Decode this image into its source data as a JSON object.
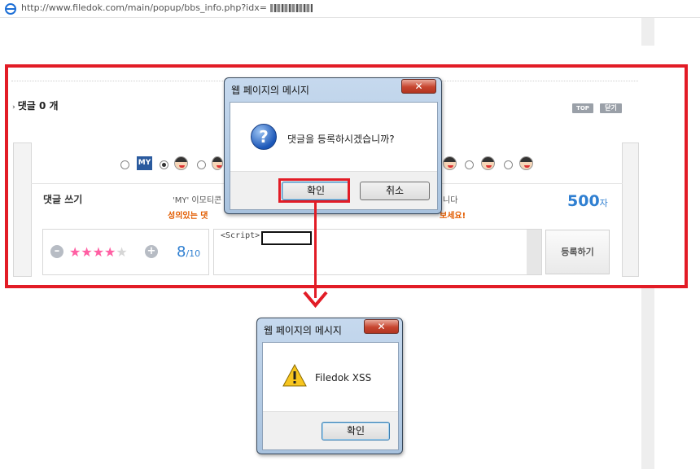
{
  "browser": {
    "url": "http://www.filedok.com/main/popup/bbs_info.php?idx="
  },
  "page": {
    "comment_count_label": "댓글 0 개",
    "top_button": "TOP",
    "close_button": "닫기",
    "emoticon_badge": "MY",
    "write_label": "댓글 쓰기",
    "notice_line1_start": "'MY' 이모티콘",
    "notice_line1_end": "니다",
    "notice_line2_start": "성의있는 댓",
    "notice_line2_end": "보세요!",
    "char_limit_value": "500",
    "char_limit_unit": "자",
    "rating": {
      "value": 8,
      "max": 10,
      "stars_filled": 4,
      "stars_total": 5,
      "score_text": "8",
      "max_text": "/10"
    },
    "comment_text": "<Script>",
    "submit_button": "등록하기"
  },
  "dialog_confirm": {
    "title": "웹 페이지의 메시지",
    "message": "댓글을 등록하시겠습니까?",
    "icon": "question-icon",
    "ok_button": "확인",
    "cancel_button": "취소"
  },
  "dialog_alert": {
    "title": "웹 페이지의 메시지",
    "message": "Filedok XSS",
    "icon": "warning-icon",
    "ok_button": "확인"
  },
  "colors": {
    "highlight_red": "#e21c26",
    "accent_blue": "#2f7fd1",
    "notice_orange": "#e25c00",
    "star_pink": "#ff5fa3"
  }
}
